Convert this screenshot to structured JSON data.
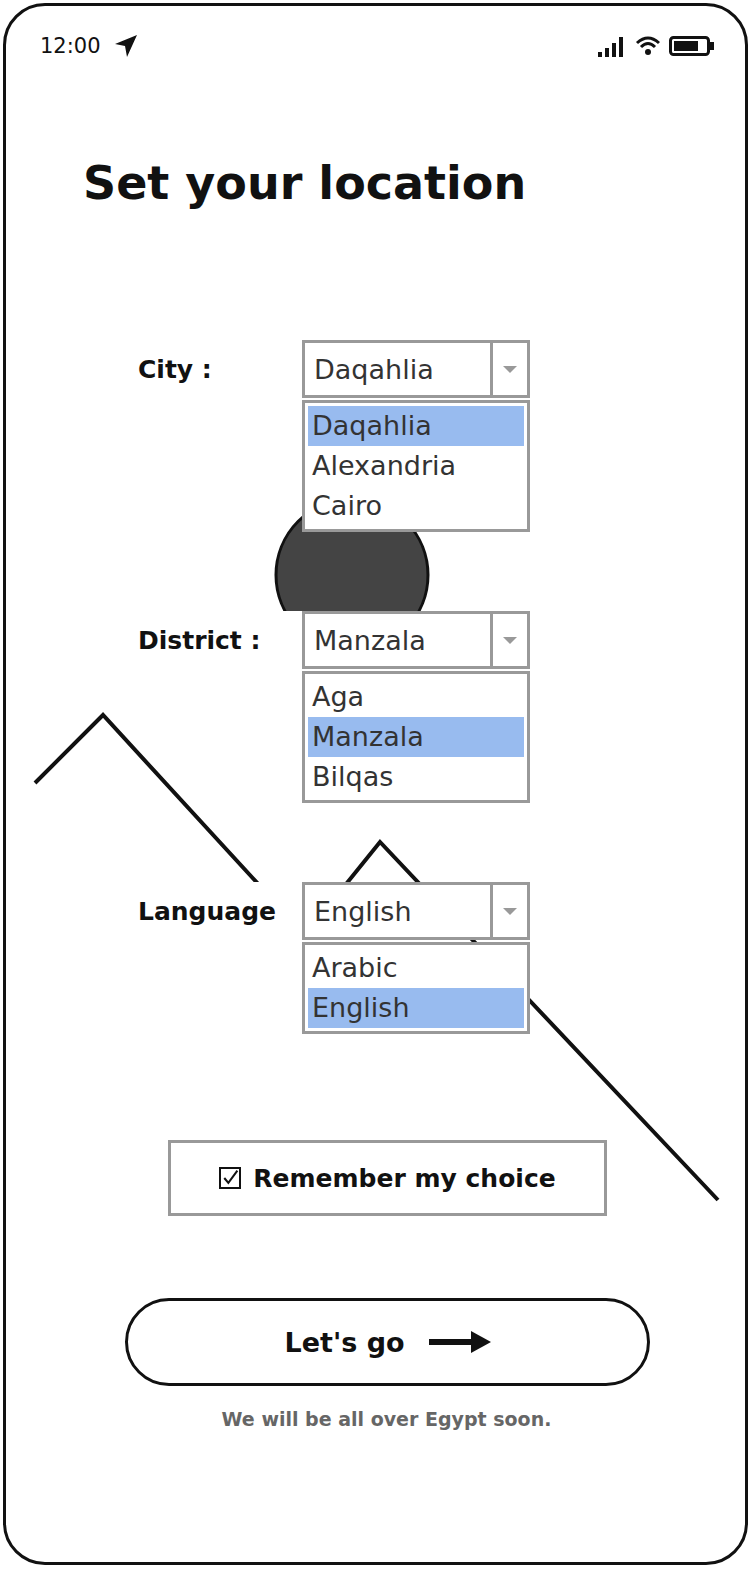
{
  "status_bar": {
    "time": "12:00"
  },
  "title": "Set your location",
  "fields": [
    {
      "label": "City :",
      "value": "Daqahlia",
      "options": [
        {
          "label": "Daqahlia",
          "selected": true
        },
        {
          "label": "Alexandria",
          "selected": false
        },
        {
          "label": "Cairo",
          "selected": false
        }
      ]
    },
    {
      "label": "District :",
      "value": "Manzala",
      "options": [
        {
          "label": "Aga",
          "selected": false
        },
        {
          "label": "Manzala",
          "selected": true
        },
        {
          "label": "Bilqas",
          "selected": false
        }
      ]
    },
    {
      "label": "Language",
      "value": "English",
      "options": [
        {
          "label": "Arabic",
          "selected": false
        },
        {
          "label": "English",
          "selected": true
        }
      ]
    }
  ],
  "remember": {
    "label": "Remember my choice",
    "checked": true
  },
  "button": {
    "label": "Let's go"
  },
  "footer": "We will be all over Egypt soon."
}
